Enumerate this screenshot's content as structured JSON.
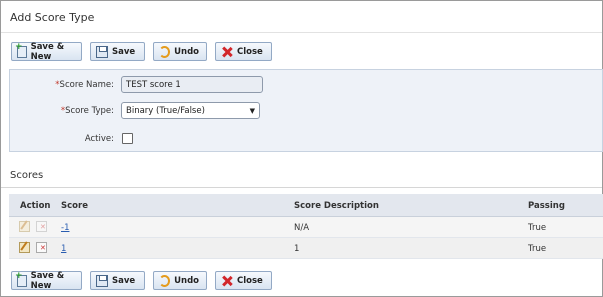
{
  "page": {
    "title": "Add Score Type"
  },
  "toolbar": {
    "save_new_label": "Save & New",
    "save_label": "Save",
    "undo_label": "Undo",
    "close_label": "Close"
  },
  "form": {
    "score_name_label": "Score Name:",
    "score_name_value": "TEST score 1",
    "score_type_label": "Score Type:",
    "score_type_value": "Binary (True/False)",
    "active_label": "Active:",
    "active_checked": false,
    "required_marker": "*"
  },
  "scores": {
    "title": "Scores",
    "columns": [
      "Action",
      "Score",
      "Score Description",
      "Passing"
    ],
    "rows": [
      {
        "score": "-1",
        "description": "N/A",
        "passing": "True"
      },
      {
        "score": "1",
        "description": "1",
        "passing": "True"
      }
    ]
  },
  "colors": {
    "button_border": "#93a9c5",
    "panel_bg": "#eef2f8",
    "required": "#c0392b",
    "link": "#2a5db0"
  },
  "icons": [
    "save-new-icon",
    "save-icon",
    "undo-icon",
    "close-icon",
    "edit-icon",
    "delete-icon",
    "select-arrow-icon"
  ]
}
